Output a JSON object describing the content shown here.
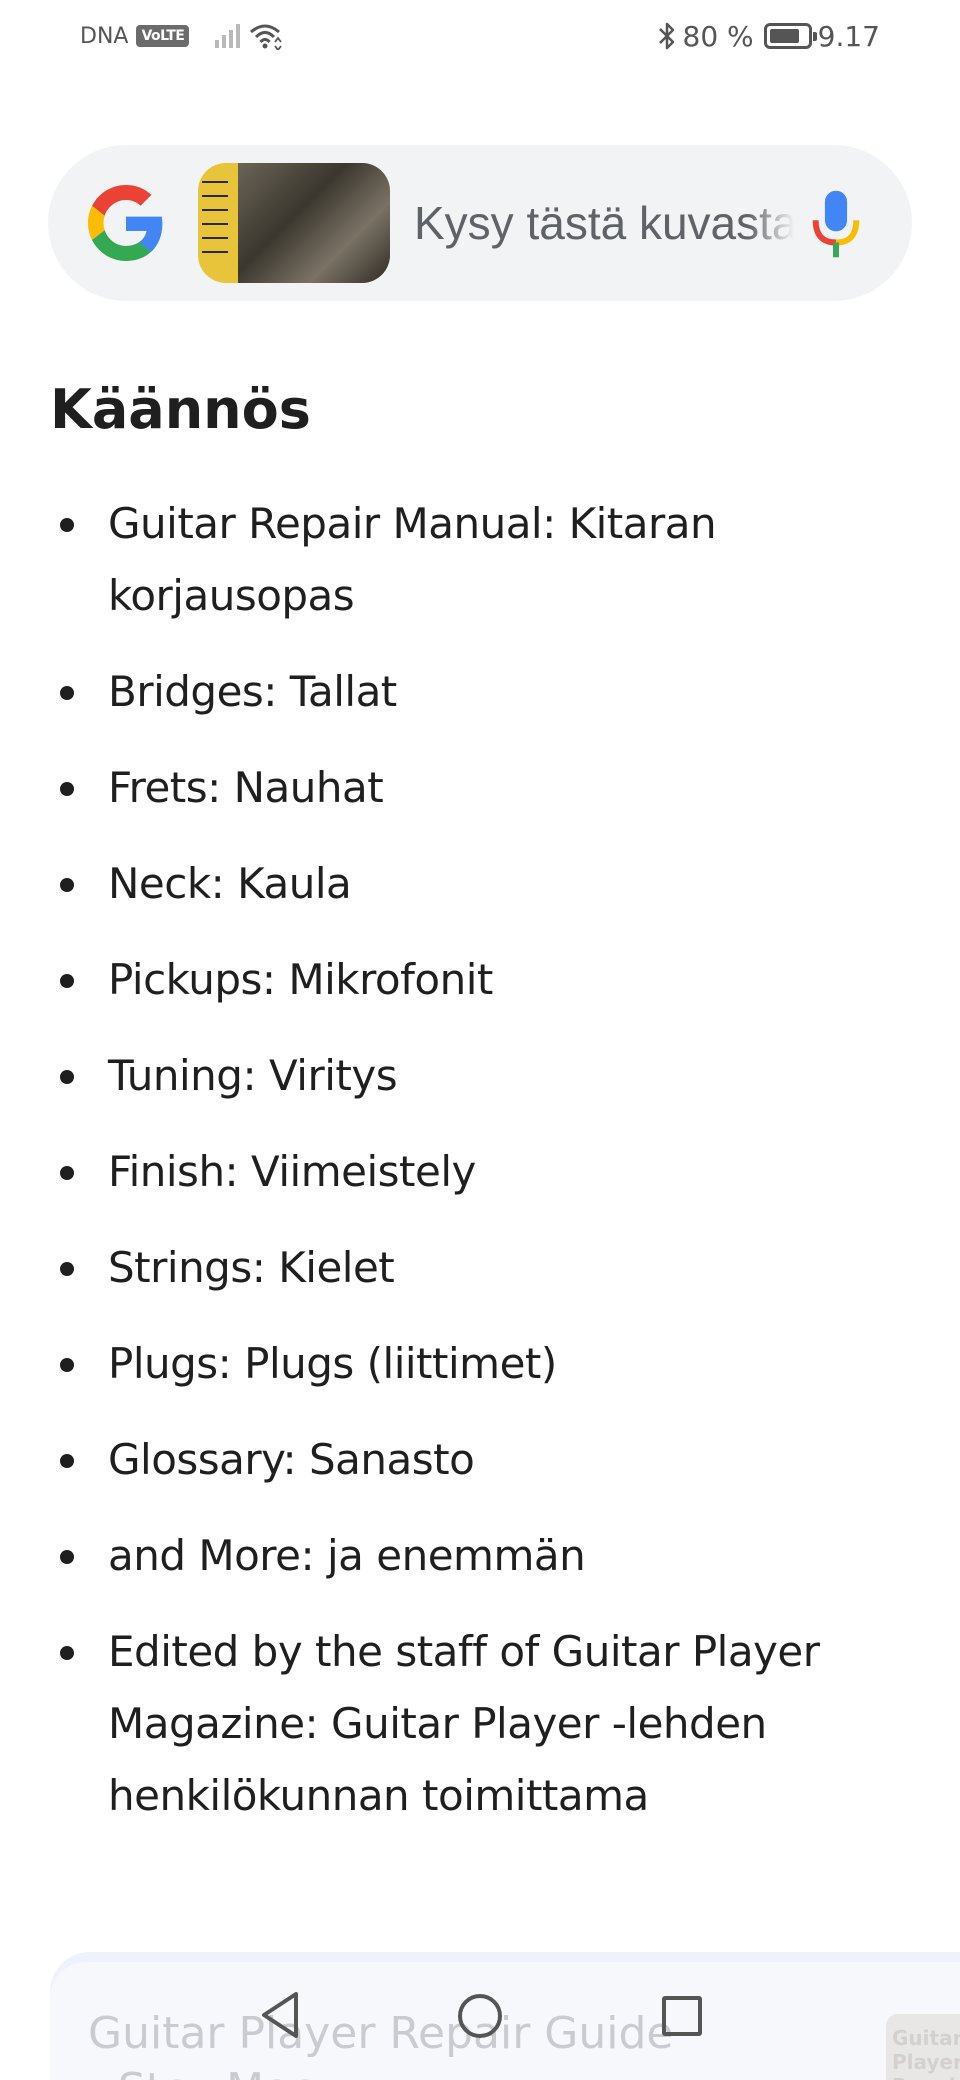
{
  "status_bar": {
    "carrier": "DNA",
    "volte": "VoLTE",
    "battery_percent": "80 %",
    "battery_level": 0.8,
    "time": "9.17",
    "icons": [
      "signal-icon",
      "wifi-icon",
      "bluetooth-icon",
      "battery-icon"
    ]
  },
  "search": {
    "placeholder": "Kysy tästä kuvasta",
    "icons": [
      "google-logo",
      "image-thumbnail",
      "mic-icon"
    ]
  },
  "translation": {
    "heading": "Käännös",
    "items": [
      "Guitar Repair Manual: Kitaran korjausopas",
      "Bridges: Tallat",
      "Frets: Nauhat",
      "Neck: Kaula",
      "Pickups: Mikrofonit",
      "Tuning: Viritys",
      "Finish: Viimeistely",
      "Strings: Kielet",
      "Plugs: Plugs (liittimet)",
      "Glossary: Sanasto",
      "and More: ja enemmän",
      "Edited by the staff of Guitar Player Magazine: Guitar Player -lehden henkilökunnan toimittama"
    ]
  },
  "result_card": {
    "title_line1": "Guitar Player Repair Guide",
    "title_line2": "- StewMac",
    "thumb_text": "Guitar Player Repair Guide"
  },
  "colors": {
    "accent_blue": "#4285F4",
    "google_red": "#EA4335",
    "google_yellow": "#FBBC05",
    "google_green": "#34A853",
    "search_bg": "#f1f3f4"
  }
}
